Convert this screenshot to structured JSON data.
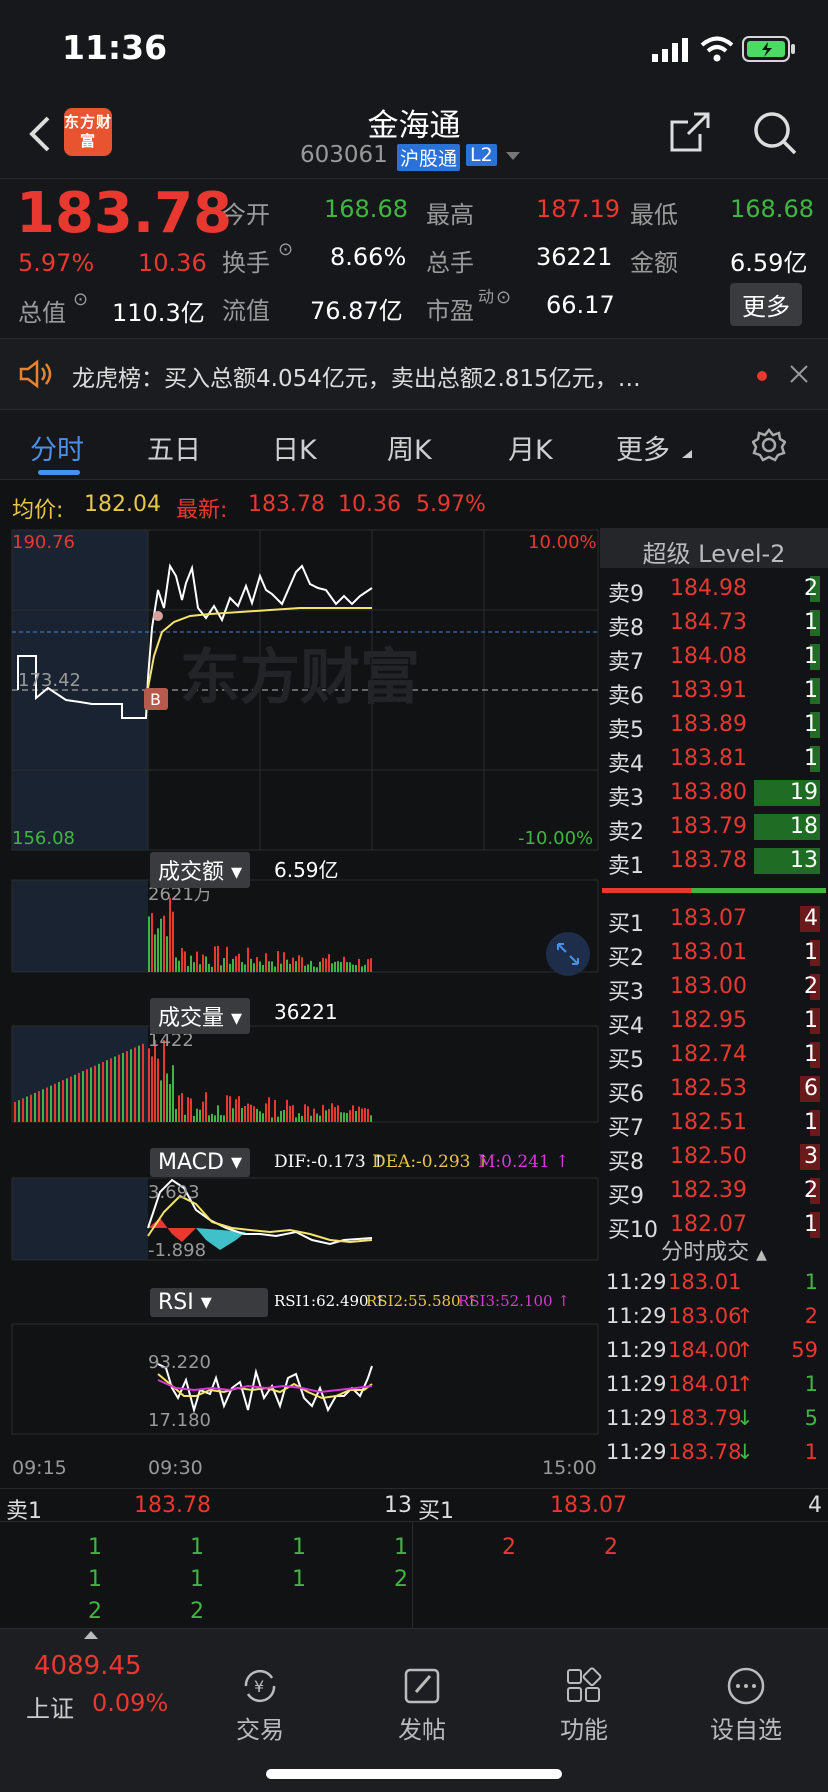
{
  "status": {
    "time": "11:36"
  },
  "nav": {
    "logo": "东方财富",
    "title": "金海通",
    "code": "603061",
    "badge1": "沪股通",
    "badge2": "L2"
  },
  "quote": {
    "price": "183.78",
    "pct": "5.97%",
    "chg": "10.36",
    "open_label": "今开",
    "open": "168.68",
    "high_label": "最高",
    "high": "187.19",
    "low_label": "最低",
    "low": "168.68",
    "turnover_label": "换手",
    "turnover": "8.66%",
    "vol_label": "总手",
    "vol": "36221",
    "amt_label": "金额",
    "amt": "6.59亿",
    "mcap_label": "总值",
    "mcap": "110.3亿",
    "float_label": "流值",
    "float": "76.87亿",
    "pe_label": "市盈",
    "pe_sup": "动",
    "pe": "66.17",
    "more": "更多"
  },
  "notice": {
    "text": "龙虎榜：买入总额4.054亿元，卖出总额2.815亿元，…"
  },
  "tabs": [
    "分时",
    "五日",
    "日K",
    "周K",
    "月K",
    "更多"
  ],
  "avg": {
    "avg_label": "均价:",
    "avg": "182.04",
    "last_label": "最新:",
    "last": "183.78",
    "chg": "10.36",
    "pct": "5.97%"
  },
  "chart": {
    "high": "190.76",
    "low": "156.08",
    "prev": "173.42",
    "pct_high": "10.00%",
    "pct_low": "-10.00%",
    "watermark": "东方财富",
    "marker": "B",
    "amount_btn": "成交额",
    "amount_val": "6.59亿",
    "amount_max": "2621万",
    "volume_btn": "成交量",
    "volume_val": "36221",
    "volume_max": "1422",
    "macd_btn": "MACD",
    "dif": "DIF:-0.173 ↑",
    "dea": "DEA:-0.293 ↑",
    "m": "M:0.241 ↑",
    "macd_max": "3.693",
    "macd_min": "-1.898",
    "rsi_btn": "RSI",
    "rsi1": "RSI1:62.490 ↑",
    "rsi2": "RSI2:55.580 ↑",
    "rsi3": "RSI3:52.100 ↑",
    "rsi_max": "93.220",
    "rsi_min": "17.180",
    "t0": "09:15",
    "t1": "09:30",
    "t2": "15:00"
  },
  "l2": {
    "title": "超级 Level-2",
    "asks": [
      {
        "n": "卖9",
        "p": "184.98",
        "v": "2"
      },
      {
        "n": "卖8",
        "p": "184.73",
        "v": "1"
      },
      {
        "n": "卖7",
        "p": "184.08",
        "v": "1"
      },
      {
        "n": "卖6",
        "p": "183.91",
        "v": "1"
      },
      {
        "n": "卖5",
        "p": "183.89",
        "v": "1"
      },
      {
        "n": "卖4",
        "p": "183.81",
        "v": "1"
      },
      {
        "n": "卖3",
        "p": "183.80",
        "v": "19"
      },
      {
        "n": "卖2",
        "p": "183.79",
        "v": "18"
      },
      {
        "n": "卖1",
        "p": "183.78",
        "v": "13"
      }
    ],
    "bids": [
      {
        "n": "买1",
        "p": "183.07",
        "v": "4"
      },
      {
        "n": "买2",
        "p": "183.01",
        "v": "1"
      },
      {
        "n": "买3",
        "p": "183.00",
        "v": "2"
      },
      {
        "n": "买4",
        "p": "182.95",
        "v": "1"
      },
      {
        "n": "买5",
        "p": "182.74",
        "v": "1"
      },
      {
        "n": "买6",
        "p": "182.53",
        "v": "6"
      },
      {
        "n": "买7",
        "p": "182.51",
        "v": "1"
      },
      {
        "n": "买8",
        "p": "182.50",
        "v": "3"
      },
      {
        "n": "买9",
        "p": "182.39",
        "v": "2"
      },
      {
        "n": "买10",
        "p": "182.07",
        "v": "1"
      }
    ],
    "ticks_title": "分时成交",
    "ticks": [
      {
        "t": "11:29",
        "p": "183.01",
        "a": "",
        "v": "1",
        "c": "green"
      },
      {
        "t": "11:29",
        "p": "183.06",
        "a": "↑",
        "v": "2",
        "c": "red"
      },
      {
        "t": "11:29",
        "p": "184.00",
        "a": "↑",
        "v": "59",
        "c": "red"
      },
      {
        "t": "11:29",
        "p": "184.01",
        "a": "↑",
        "v": "1",
        "c": "green"
      },
      {
        "t": "11:29",
        "p": "183.79",
        "a": "↓",
        "v": "5",
        "c": "green"
      },
      {
        "t": "11:29",
        "p": "183.78",
        "a": "↓",
        "v": "1",
        "c": "red"
      }
    ]
  },
  "bottom": {
    "sell_label": "卖1",
    "sell_price": "183.78",
    "sell_qty": "13",
    "buy_label": "买1",
    "buy_price": "183.07",
    "buy_qty": "4",
    "sell_rows": [
      [
        "1",
        "1",
        "1",
        "1"
      ],
      [
        "1",
        "1",
        "1",
        "2"
      ],
      [
        "2",
        "2",
        "",
        ""
      ]
    ],
    "buy_rows": [
      [
        "2",
        "2"
      ]
    ]
  },
  "bar": {
    "index_val": "4089.45",
    "index_name": "上证",
    "index_pct": "0.09%",
    "trade": "交易",
    "post": "发帖",
    "func": "功能",
    "watch": "设自选"
  }
}
